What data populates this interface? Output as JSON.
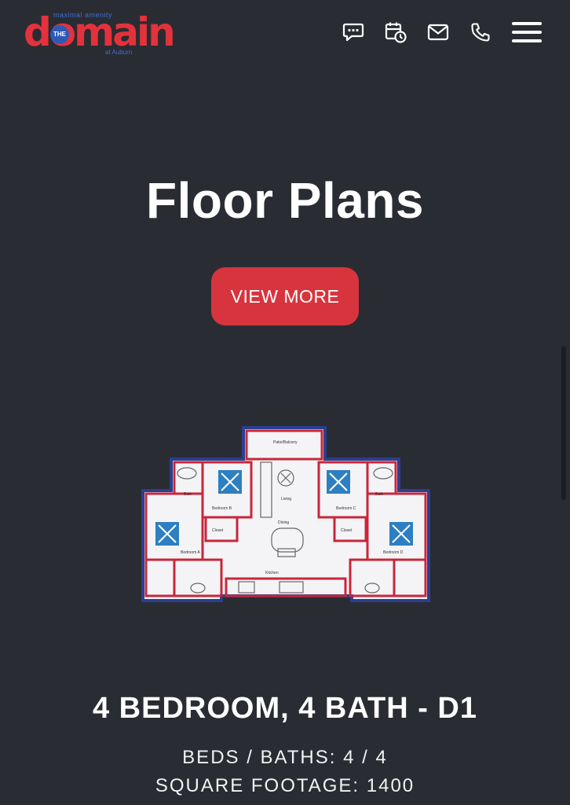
{
  "header": {
    "logo": {
      "top_text": "maximal amenity",
      "word": "domain",
      "the_badge": "THE",
      "bottom_text": "at Auburn"
    },
    "icons": [
      "chat-icon",
      "calendar-clock-icon",
      "mail-icon",
      "phone-icon",
      "menu-icon"
    ]
  },
  "hero": {
    "title": "Floor Plans",
    "button_label": "VIEW MORE"
  },
  "plan": {
    "title": "4 BEDROOM, 4 BATH - D1",
    "beds_baths": "BEDS / BATHS: 4 / 4",
    "square_footage": "SQUARE FOOTAGE: 1400",
    "image_labels": {
      "patio": "Patio/Balcony",
      "living": "Living",
      "dining": "Dining",
      "kitchen": "Kitchen",
      "bed_a": "Bedroom A",
      "bed_b": "Bedroom B",
      "bed_c": "Bedroom C",
      "bed_d": "Bedroom D",
      "bath": "Bath",
      "closet": "Closet"
    }
  },
  "colors": {
    "background": "#2a2c33",
    "accent": "#d8343e",
    "plan_wall_red": "#c8263a",
    "plan_wall_blue": "#2a3f8f",
    "plan_window": "#2d7fc2"
  }
}
